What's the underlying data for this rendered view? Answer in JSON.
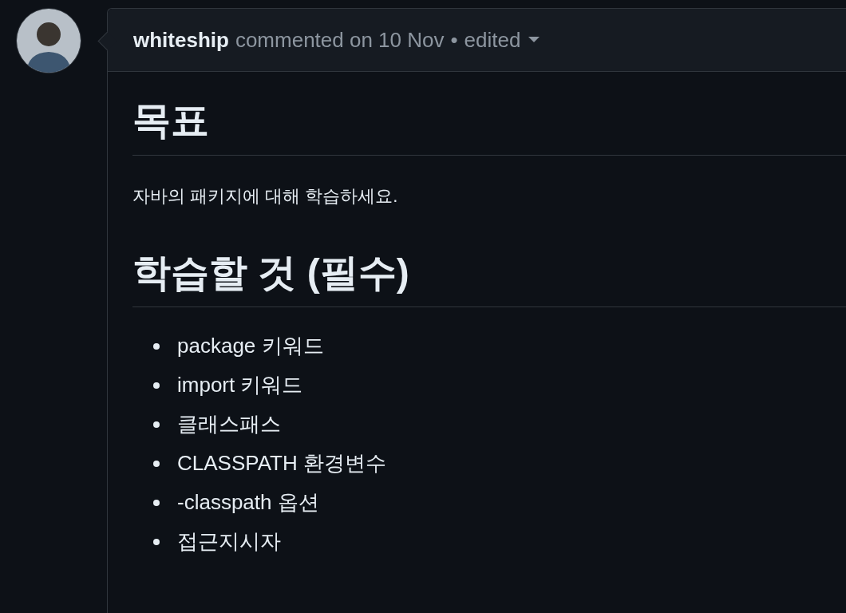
{
  "comment": {
    "author": "whiteship",
    "action": "commented on 10 Nov",
    "separator": "•",
    "edited": "edited"
  },
  "body": [
    {
      "kind": "heading",
      "text": "목표"
    },
    {
      "kind": "paragraph",
      "text": "자바의 패키지에 대해 학습하세요."
    },
    {
      "kind": "heading",
      "text": "학습할 것 (필수)"
    },
    {
      "kind": "list",
      "items": [
        "package 키워드",
        "import 키워드",
        "클래스패스",
        "CLASSPATH 환경변수",
        "-classpath 옵션",
        "접근지시자"
      ]
    }
  ]
}
